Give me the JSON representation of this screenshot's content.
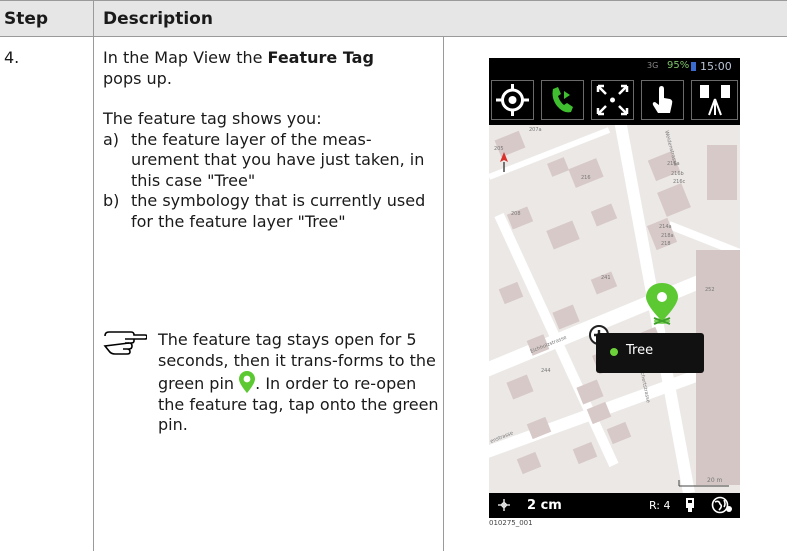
{
  "header": {
    "step_label": "Step",
    "description_label": "Description"
  },
  "row": {
    "step": "4.",
    "intro_prefix": "In the Map View the ",
    "intro_bold": "Feature Tag",
    "intro_suffix": "pops up.",
    "shows_heading": "The feature tag shows you:",
    "items": [
      {
        "label": "a)",
        "text": "the feature layer of the meas-urement that you have just taken, in this case \"Tree\""
      },
      {
        "label": "b)",
        "text": "the symbology that is currently used for the feature layer \"Tree\""
      }
    ],
    "note_part1": "The feature tag stays open for 5 seconds, then it trans-forms to the green pin",
    "note_part2": ". In order to re-open the feature tag, tap onto the green pin."
  },
  "screenshot": {
    "status": {
      "signal": "3G",
      "battery": "95%",
      "time": "15:00"
    },
    "toolbar_buttons": [
      "target-icon",
      "phone-play-icon",
      "zoom-extent-icon",
      "hand-tap-icon",
      "total-station-icon"
    ],
    "map_labels": [
      "205",
      "207a",
      "216a",
      "216b",
      "216c",
      "216",
      "208",
      "214a",
      "218a",
      "218",
      "241",
      "252",
      "248",
      "244",
      "Eichholzstrasse",
      "Weidenstrasse",
      "Dischertstrasse",
      "enstrasse",
      "20 m"
    ],
    "feature_tag": "Tree",
    "bottom": {
      "distance": "2 cm",
      "r": "R: 4"
    },
    "colors": {
      "pin": "#5cc832",
      "toolbar": "#000000",
      "accent_green": "#3fbf2f"
    },
    "figure_id": "010275_001"
  }
}
